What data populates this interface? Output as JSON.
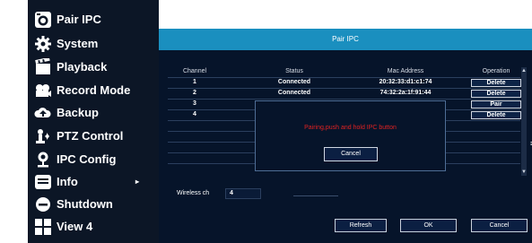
{
  "menu": {
    "items": [
      {
        "label": "Pair IPC",
        "icon": "camera-icon"
      },
      {
        "label": "System",
        "icon": "gear-icon"
      },
      {
        "label": "Playback",
        "icon": "playback-icon"
      },
      {
        "label": "Record Mode",
        "icon": "record-mode-icon"
      },
      {
        "label": "Backup",
        "icon": "cloud-upload-icon"
      },
      {
        "label": "PTZ Control",
        "icon": "ptz-icon"
      },
      {
        "label": "IPC Config",
        "icon": "ipc-config-icon"
      },
      {
        "label": "Info",
        "icon": "info-list-icon"
      },
      {
        "label": "Shutdown",
        "icon": "shutdown-icon"
      },
      {
        "label": "View 4",
        "icon": "view-grid-icon"
      }
    ],
    "info_arrow": "▸"
  },
  "dialog": {
    "title": "Pair IPC",
    "columns": [
      "Channel",
      "Status",
      "Mac Address",
      "Operation"
    ],
    "rows": [
      {
        "channel": "1",
        "status": "Connected",
        "mac": "20:32:33:d1:c1:74",
        "operation": "Delete"
      },
      {
        "channel": "2",
        "status": "Connected",
        "mac": "74:32:2a:1f:91:44",
        "operation": "Delete"
      },
      {
        "channel": "3",
        "status": "",
        "mac": "",
        "operation": "Pair"
      },
      {
        "channel": "4",
        "status": "",
        "mac": "",
        "operation": "Delete"
      }
    ],
    "wireless": {
      "label": "Wireless ch",
      "value": "4"
    },
    "buttons": {
      "refresh": "Refresh",
      "ok": "OK",
      "cancel": "Cancel"
    }
  },
  "popup": {
    "message": "Pairing,push and hold IPC button",
    "cancel": "Cancel"
  },
  "colors": {
    "menu_bg": "#0c1626",
    "titlebar": "#1a8fbf",
    "dialog_bg": "#06142a",
    "popup_message": "#e02222"
  }
}
